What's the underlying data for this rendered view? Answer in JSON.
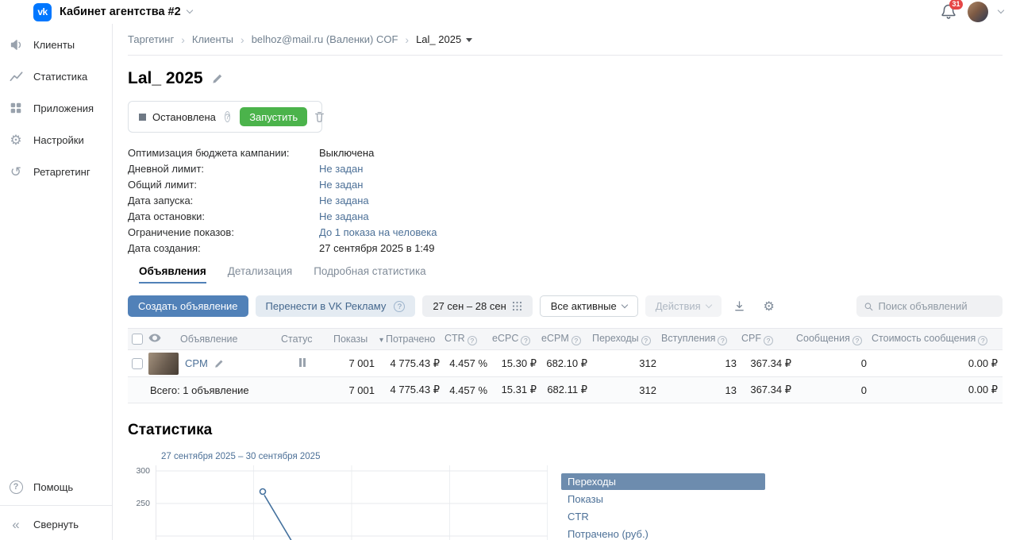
{
  "brand": {
    "logo_text": "vk",
    "workspace_title": "Кабинет агентства #2"
  },
  "topbar": {
    "notification_count": "31"
  },
  "glyphs": {
    "sort_desc": "▾",
    "collapse": "«",
    "gear": "⚙",
    "retarget": "↺",
    "help": "?",
    "crumb_sep": "›"
  },
  "sidebar": {
    "items": [
      {
        "label": "Клиенты",
        "icon": "clients-megaphone-icon"
      },
      {
        "label": "Статистика",
        "icon": "statistics-graph-icon"
      },
      {
        "label": "Приложения",
        "icon": "apps-grid-icon"
      },
      {
        "label": "Настройки",
        "icon": "settings-gear-icon"
      },
      {
        "label": "Ретаргетинг",
        "icon": "retargeting-arrow-icon"
      }
    ],
    "help_label": "Помощь",
    "collapse_label": "Свернуть"
  },
  "breadcrumb": {
    "items": [
      "Таргетинг",
      "Клиенты",
      "belhoz@mail.ru (Валенки) COF"
    ],
    "current": "Lal_ 2025"
  },
  "campaign": {
    "title": "Lal_ 2025",
    "status_label": "Остановлена",
    "start_button": "Запустить",
    "details": [
      {
        "label": "Оптимизация бюджета кампании:",
        "value": "Выключена",
        "link": false
      },
      {
        "label": "Дневной лимит:",
        "value": "Не задан",
        "link": true
      },
      {
        "label": "Общий лимит:",
        "value": "Не задан",
        "link": true
      },
      {
        "label": "Дата запуска:",
        "value": "Не задана",
        "link": true
      },
      {
        "label": "Дата остановки:",
        "value": "Не задана",
        "link": true
      },
      {
        "label": "Ограничение показов:",
        "value": "До 1 показа на человека",
        "link": true
      },
      {
        "label": "Дата создания:",
        "value": "27 сентября 2025 в 1:49",
        "link": false
      }
    ]
  },
  "tabs": [
    {
      "label": "Объявления",
      "active": true
    },
    {
      "label": "Детализация",
      "active": false
    },
    {
      "label": "Подробная статистика",
      "active": false
    }
  ],
  "toolbar": {
    "create_button": "Создать объявление",
    "transfer_button": "Перенести в VK Рекламу",
    "date_range": "27 сен – 28 сен",
    "filter_value": "Все активные",
    "actions_button": "Действия",
    "search_placeholder": "Поиск объявлений"
  },
  "table": {
    "columns": [
      "Объявление",
      "Статус",
      "Показы",
      "Потрачено",
      "CTR",
      "eCPC",
      "eCPM",
      "Переходы",
      "Вступления",
      "CPF",
      "Сообщения",
      "Стоимость сообщения"
    ],
    "row": {
      "name": "CPM",
      "status": "paused",
      "impressions": "7 001",
      "spent": "4 775.43 ₽",
      "ctr": "4.457 %",
      "ecpc": "15.30 ₽",
      "ecpm": "682.10 ₽",
      "clicks": "312",
      "joins": "13",
      "cpf": "367.34 ₽",
      "messages": "0",
      "message_cost": "0.00 ₽"
    },
    "total": {
      "label": "Всего: 1 объявление",
      "impressions": "7 001",
      "spent": "4 775.43 ₽",
      "ctr": "4.457 %",
      "ecpc": "15.31 ₽",
      "ecpm": "682.11 ₽",
      "clicks": "312",
      "joins": "13",
      "cpf": "367.34 ₽",
      "messages": "0",
      "message_cost": "0.00 ₽"
    }
  },
  "stats": {
    "heading": "Статистика",
    "period": "27 сентября 2025 – 30 сентября 2025",
    "yticks": [
      "300",
      "250"
    ],
    "legend": [
      {
        "label": "Переходы",
        "selected": true
      },
      {
        "label": "Показы",
        "selected": false
      },
      {
        "label": "CTR",
        "selected": false
      },
      {
        "label": "Потрачено (руб.)",
        "selected": false
      }
    ]
  },
  "chart_data": {
    "type": "line",
    "title": "Статистика",
    "period_label": "27 сентября 2025 – 30 сентября 2025",
    "x_range": [
      "27 сентября 2025",
      "30 сентября 2025"
    ],
    "visible_yticks": [
      300,
      250
    ],
    "grid": true,
    "legend_position": "right",
    "selected_metric": "Переходы",
    "legend": [
      "Переходы",
      "Показы",
      "CTR",
      "Потрачено (руб.)"
    ],
    "series": [
      {
        "name": "Переходы",
        "points": [
          {
            "x": "≈28 сентября 2025",
            "y": 268
          }
        ],
        "note": "one hollow marker at ≈268; line falls steeply below 250 toward the next day and continues past the bottom edge of the visible area (chart cropped by screenshot)"
      }
    ]
  },
  "colors": {
    "vk_blue": "#0077FF",
    "button_blue": "#5181B8",
    "link_blue": "#4C7097",
    "green": "#4BB34B",
    "badge_red": "#E64646",
    "legend_selected_bg": "#6D8CAE"
  }
}
